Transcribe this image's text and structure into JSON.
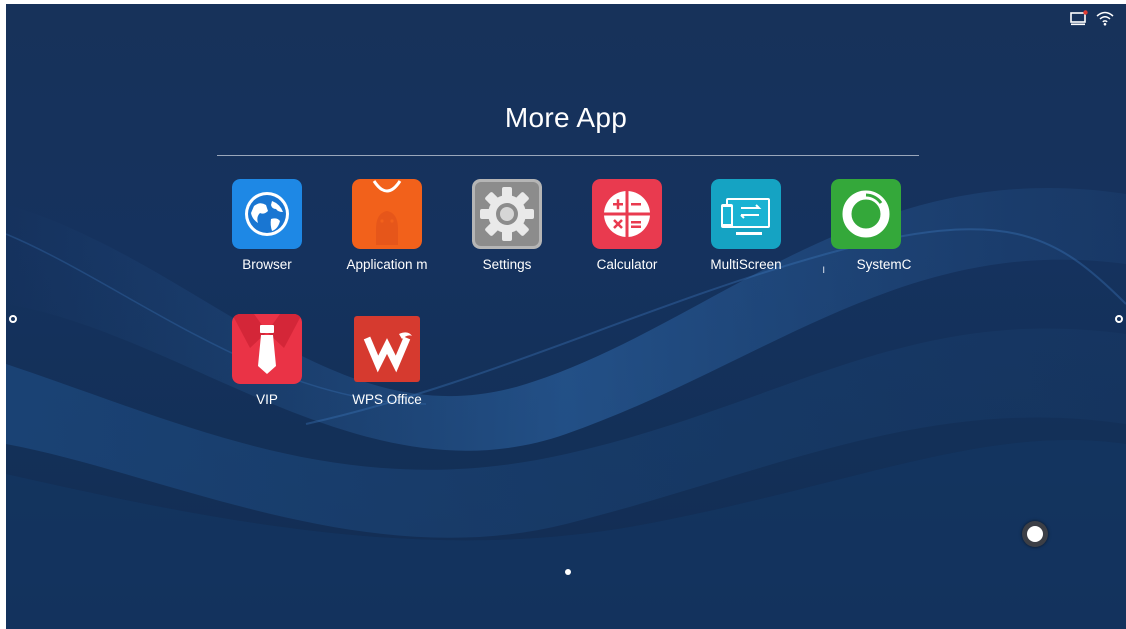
{
  "title": "More App",
  "status_bar": {
    "icons": [
      "screen-cast-icon",
      "wifi-icon"
    ],
    "notification_color": "#e0392f"
  },
  "apps": [
    {
      "label": "Browser",
      "icon": "globe-icon",
      "color": "#1e88e5"
    },
    {
      "label": "Application m",
      "icon": "android-bag-icon",
      "color": "#f2611b"
    },
    {
      "label": "Settings",
      "icon": "gear-icon",
      "color": "#8c8c8c"
    },
    {
      "label": "Calculator",
      "icon": "calculator-icon",
      "color": "#e93a4f"
    },
    {
      "label": "MultiScreen",
      "icon": "multiscreen-icon",
      "color": "#15a3c3"
    },
    {
      "label": "SystemC",
      "icon": "ring-icon",
      "color": "#34a83a"
    },
    {
      "label": "VIP",
      "icon": "tie-icon",
      "color": "#ea3346"
    },
    {
      "label": "WPS Office",
      "icon": "wps-icon",
      "color": "#d63a2f"
    }
  ],
  "stray_text": "ı",
  "pager": {
    "pages": 1,
    "current": 1
  },
  "accent": "#15325e"
}
